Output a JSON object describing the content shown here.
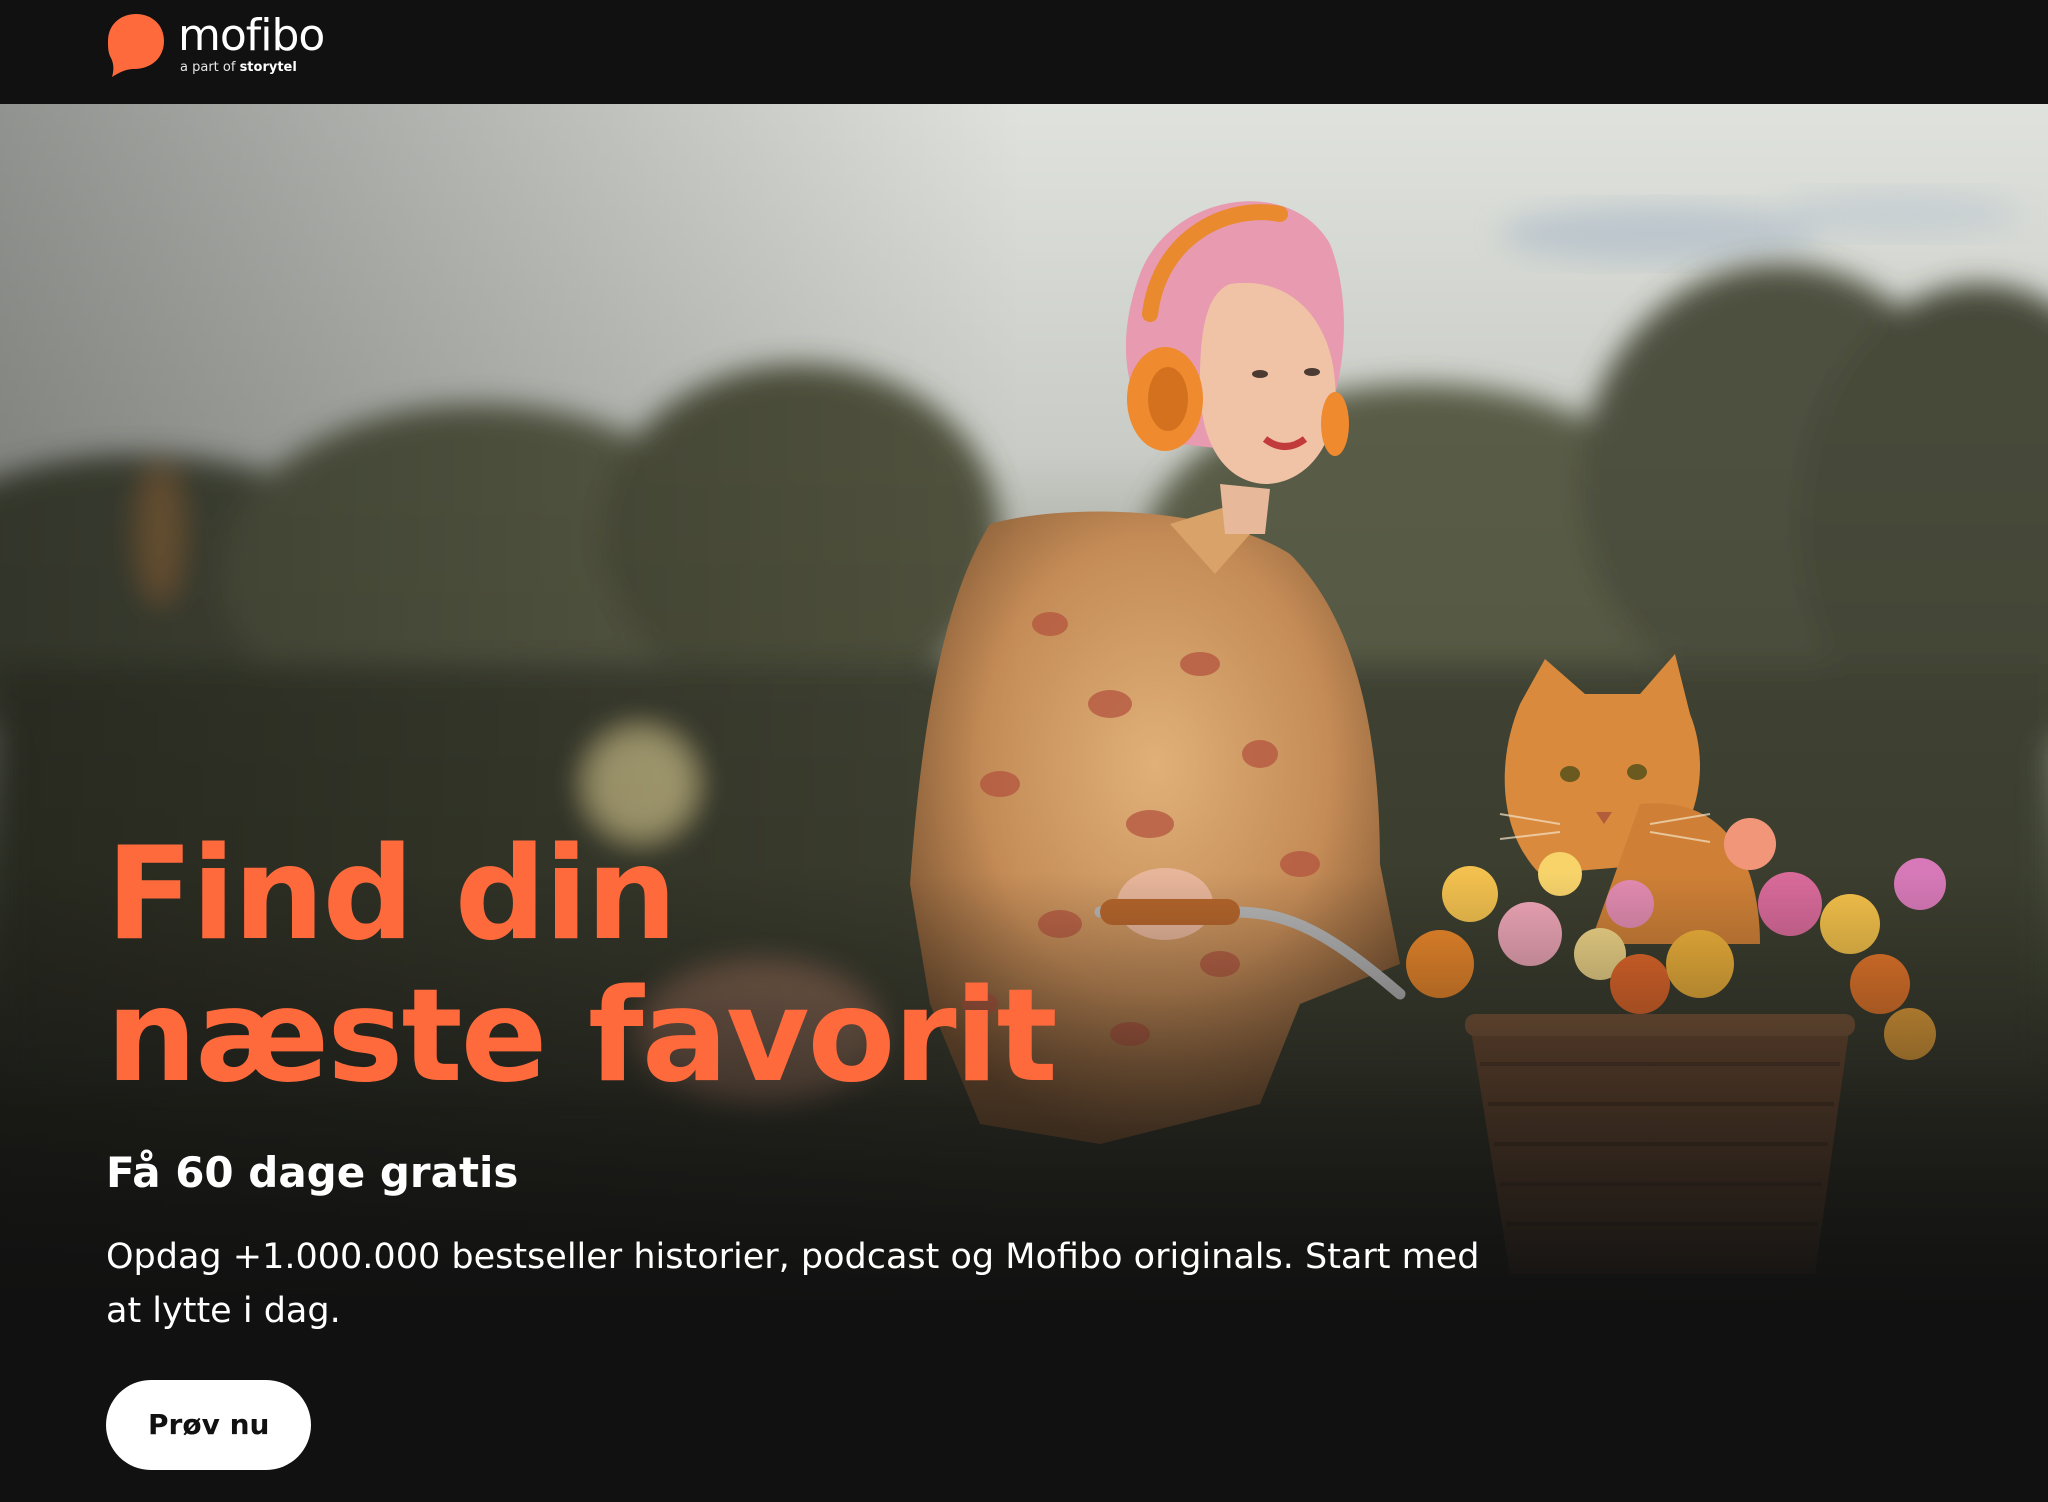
{
  "header": {
    "logo": {
      "wordmark": "mofibo",
      "tagline_prefix": "a part of",
      "tagline_brand": "storytel",
      "icon": "speech-bubble-logo-icon"
    }
  },
  "hero": {
    "headline": "Find din næste favorit",
    "subheadline": "Få 60 dage gratis",
    "description": "Opdag +1.000.000 bestseller historier, podcast og Mofibo originals. Start med at lytte i dag.",
    "cta_label": "Prøv nu",
    "image": "woman-with-headphones-on-bicycle-with-cat-in-flower-basket"
  },
  "colors": {
    "page_background": "#111111",
    "brand_orange": "#ff6a3d",
    "text_white": "#ffffff",
    "button_background": "#ffffff",
    "button_text": "#111111"
  }
}
